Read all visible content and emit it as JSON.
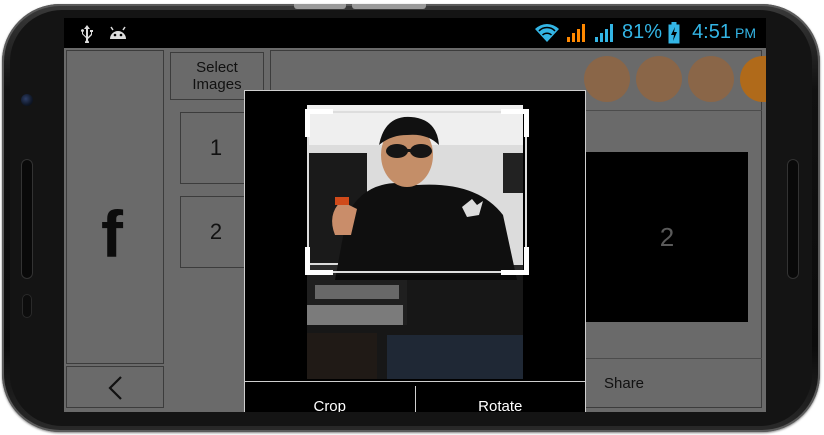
{
  "status_bar": {
    "battery": "81%",
    "time": "4:51",
    "ampm": "PM",
    "icons": [
      "usb-icon",
      "android-debug-icon",
      "wifi-icon",
      "signal-orange-icon",
      "signal-blue-icon",
      "battery-charging-icon"
    ]
  },
  "sidebar": {
    "facebook_label": "f"
  },
  "select_images": {
    "label_line1": "Select",
    "label_line2": "Images"
  },
  "image_slots": [
    "1",
    "2"
  ],
  "preview": {
    "number": "2"
  },
  "share": {
    "label": "Share"
  },
  "crop_dialog": {
    "crop_label": "Crop",
    "rotate_label": "Rotate"
  },
  "colors": {
    "status_accent": "#33b5e5",
    "signal_orange": "#ff8800",
    "app_background": "#6a6a6a",
    "swatch": "#8a6648",
    "swatch_accent": "#b06a1a"
  }
}
